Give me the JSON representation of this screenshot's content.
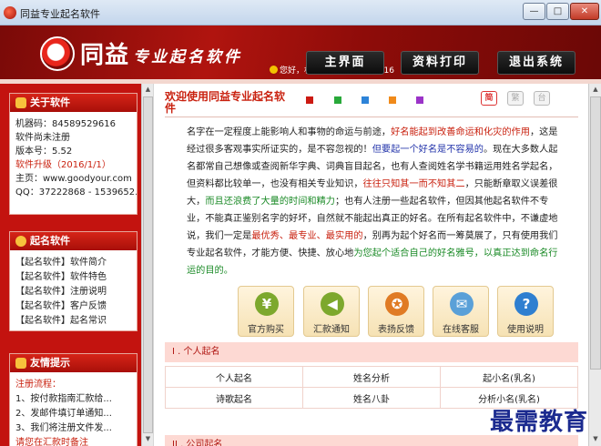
{
  "window": {
    "title": "同益专业起名软件",
    "min": "—",
    "max": "□",
    "close": "✕"
  },
  "banner": {
    "logo_text": "同益",
    "logo_sub": "专业起名软件",
    "greeting": "您好，机器码：84589529616",
    "nav": {
      "main": "主界面",
      "print": "资料打印",
      "exit": "退出系统"
    }
  },
  "sidebar": {
    "about": {
      "title": "关于软件",
      "machine": "机器码：84589529616",
      "reg_status": "软件尚未注册",
      "version": "版本号：5.52",
      "upgrade": "软件升级（2016/1/1）",
      "homepage": "主页：www.goodyour.com",
      "qq": "QQ：37222868 - 1539652..."
    },
    "naming": {
      "title": "起名软件",
      "items": [
        "【起名软件】软件简介",
        "【起名软件】软件特色",
        "【起名软件】注册说明",
        "【起名软件】客户反馈",
        "【起名软件】起名常识"
      ]
    },
    "tips": {
      "title": "友情提示",
      "flow": "注册流程：",
      "items": [
        "1、按付款指南汇款给...",
        "2、发邮件填订单通知...",
        "3、我们将注册文件发..."
      ],
      "warn": "请您在汇款时备注"
    }
  },
  "main": {
    "welcome": "欢迎使用同益专业起名软件",
    "colors": [
      "#cc1a12",
      "#29a93a",
      "#2d83d8",
      "#f08a1a",
      "#9b33c8"
    ],
    "toggles": [
      "简",
      "繁",
      "台"
    ],
    "intro": {
      "p1": "名字在一定程度上能影响人和事物的命运与前途，",
      "p2": "好名能起到改善命运和化灾的作用",
      "p3": "，这是经过很多客观事实所证实的，是不容忽视的！",
      "p4": "但要起一个好名是不容易的",
      "p5": "。现在大多数人起名都常自己想像或查阅新华字典、词典盲目起名，也有人查阅姓名学书籍运用姓名学起名，但资料都比较单一，也没有相关专业知识，",
      "p6": "往往只知其一而不知其二",
      "p7": "，只能断章取义误差很大，",
      "p8": "而且还浪费了大量的时间和精力",
      "p9": "；也有人注册一些起名软件，但因其他起名软件不专业，不能真正鉴别名字的好坏，自然就不能起出真正的好名。在所有起名软件中，不谦虚地说，我们一定是",
      "p10": "最优秀、最专业、最实用的",
      "p11": "，别再为起个好名而一筹莫展了，只有使用我们专业起名软件，才能方便、快捷、放心地",
      "p12": "为您起个适合自己的好名雅号，以真正达到命名行运的目的。"
    },
    "tiles": [
      {
        "label": "官方购买",
        "icon": "yuan-icon",
        "glyph": "¥",
        "color": "#7da82d"
      },
      {
        "label": "汇款通知",
        "icon": "megaphone-icon",
        "glyph": "◀",
        "color": "#7da82d"
      },
      {
        "label": "表扬反馈",
        "icon": "medal-icon",
        "glyph": "✪",
        "color": "#e07b24"
      },
      {
        "label": "在线客服",
        "icon": "chat-icon",
        "glyph": "✉",
        "color": "#5aa0d8"
      },
      {
        "label": "使用说明",
        "icon": "help-icon",
        "glyph": "?",
        "color": "#2f7fd0"
      }
    ],
    "section1": {
      "title": "I . 个人起名",
      "rows": [
        [
          "个人起名",
          "姓名分析",
          "起小名(乳名)"
        ],
        [
          "诗歌起名",
          "姓名八卦",
          "分析小名(乳名)"
        ]
      ]
    },
    "section2": {
      "title": "II . 公司起名"
    }
  },
  "watermark": "最需教育"
}
